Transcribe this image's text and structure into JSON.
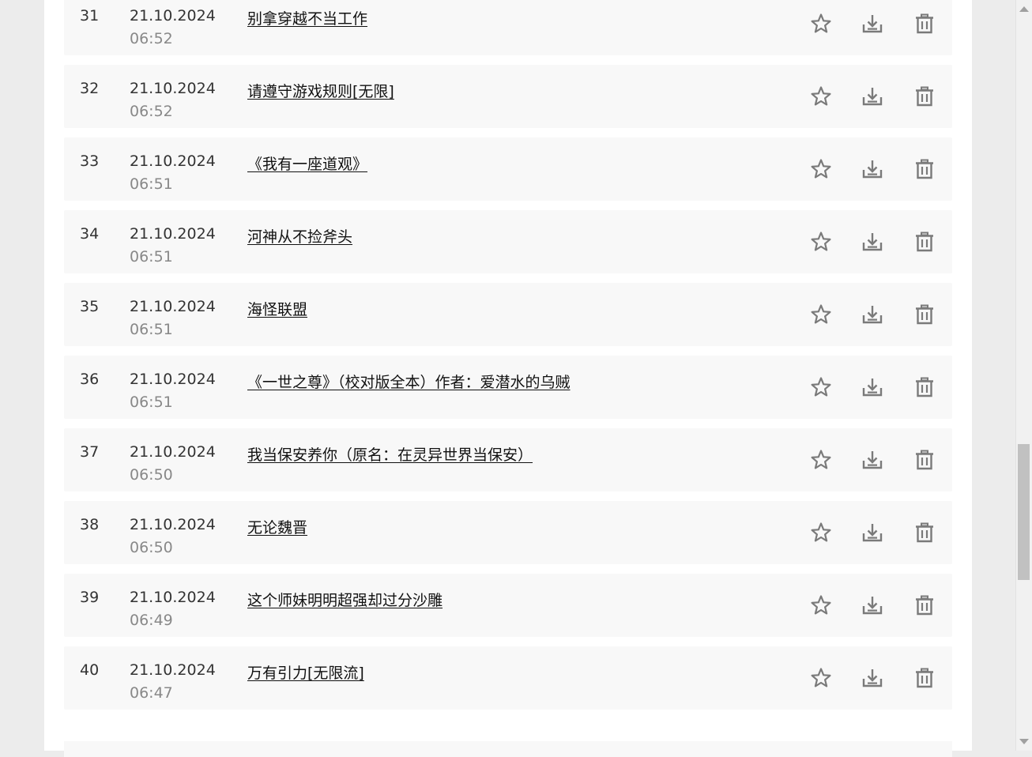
{
  "colors": {
    "background": "#ececec",
    "panel": "#ffffff",
    "row": "#f8f8f8",
    "icon": "#7a7a7a",
    "text": "#333333",
    "time_text": "#888888"
  },
  "icons": {
    "favorite": "star-icon",
    "download": "download-icon",
    "delete": "trash-icon"
  },
  "rows": [
    {
      "num": "31",
      "date": "21.10.2024",
      "time": "06:52",
      "title": "别拿穿越不当工作"
    },
    {
      "num": "32",
      "date": "21.10.2024",
      "time": "06:52",
      "title": "请遵守游戏规则[无限]"
    },
    {
      "num": "33",
      "date": "21.10.2024",
      "time": "06:51",
      "title": "《我有一座道观》"
    },
    {
      "num": "34",
      "date": "21.10.2024",
      "time": "06:51",
      "title": "河神从不捡斧头"
    },
    {
      "num": "35",
      "date": "21.10.2024",
      "time": "06:51",
      "title": "海怪联盟"
    },
    {
      "num": "36",
      "date": "21.10.2024",
      "time": "06:51",
      "title": "《一世之尊》（校对版全本）作者：爱潜水的乌贼"
    },
    {
      "num": "37",
      "date": "21.10.2024",
      "time": "06:50",
      "title": "我当保安养你（原名：在灵异世界当保安）"
    },
    {
      "num": "38",
      "date": "21.10.2024",
      "time": "06:50",
      "title": "无论魏晋"
    },
    {
      "num": "39",
      "date": "21.10.2024",
      "time": "06:49",
      "title": "这个师妹明明超强却过分沙雕"
    },
    {
      "num": "40",
      "date": "21.10.2024",
      "time": "06:47",
      "title": "万有引力[无限流]"
    }
  ]
}
